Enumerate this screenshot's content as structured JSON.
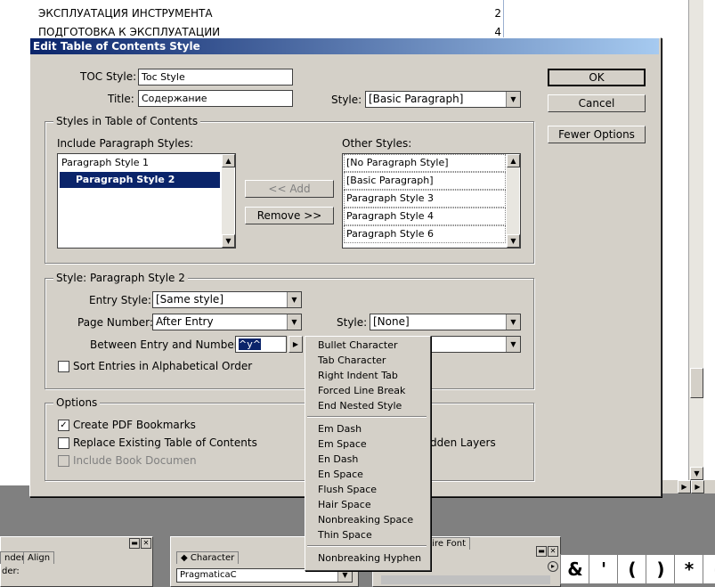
{
  "document": {
    "lines": [
      {
        "text": "ЭКСПЛУАТАЦИЯ ИНСТРУМЕНТА",
        "page": "2"
      },
      {
        "text": "ПОДГОТОВКА К ЭКСПЛУАТАЦИИ",
        "page": "4"
      }
    ]
  },
  "dialog": {
    "title": "Edit Table of Contents Style",
    "toc_style_label": "TOC Style:",
    "toc_style_value": "Toc Style",
    "title_label": "Title:",
    "title_value": "Содержание",
    "style_label": "Style:",
    "style_value": "[Basic Paragraph]",
    "buttons": {
      "ok": "OK",
      "cancel": "Cancel",
      "fewer_options": "Fewer Options",
      "add": "<< Add",
      "remove": "Remove >>"
    },
    "styles_group": {
      "title": "Styles in Table of Contents",
      "include_label": "Include Paragraph Styles:",
      "include_items": [
        "Paragraph Style 1",
        "Paragraph Style 2"
      ],
      "selected_include": "Paragraph Style 2",
      "other_label": "Other Styles:",
      "other_items": [
        "[No Paragraph Style]",
        "[Basic Paragraph]",
        "Paragraph Style 3",
        "Paragraph Style 4",
        "Paragraph Style 6"
      ]
    },
    "style_group": {
      "title": "Style: Paragraph Style 2",
      "entry_style_label": "Entry Style:",
      "entry_style_value": "[Same style]",
      "page_number_label": "Page Number:",
      "page_number_value": "After Entry",
      "style_label": "Style:",
      "style_value": "[None]",
      "between_label": "Between Entry and Number:",
      "between_value": "^y^",
      "sort_label": "Sort Entries in Alphabetical Order",
      "sort_checked": false
    },
    "options_group": {
      "title": "Options",
      "create_pdf": "Create PDF Bookmarks",
      "create_pdf_checked": true,
      "replace_existing": "Replace Existing Table of Contents",
      "replace_checked": false,
      "include_book": "Include Book Documen",
      "include_book_disabled": true,
      "hidden_layers_partial": "dden Layers"
    }
  },
  "menu": {
    "group1": [
      "Bullet Character",
      "Tab Character",
      "Right Indent Tab",
      "Forced Line Break",
      "End Nested Style"
    ],
    "group2": [
      "Em Dash",
      "Em Space",
      "En Dash",
      "En Space",
      "Flush Space",
      "Hair Space",
      "Nonbreaking Space",
      "Thin Space"
    ],
    "group3": [
      "Nonbreaking Hyphen"
    ]
  },
  "panels": {
    "left_tab1": "nder",
    "left_tab2": "Align",
    "left_label": "der:",
    "character_tab": "Character",
    "font_value": "PragmaticaC",
    "right_tab": "ntire Font",
    "glyphs": [
      "&",
      "'",
      "(",
      ")",
      "*",
      "-"
    ]
  },
  "colors": {
    "titlebar_start": "#0a246a",
    "titlebar_end": "#a6caf0",
    "dialog_bg": "#d4d0c8",
    "selection": "#0a246a"
  }
}
